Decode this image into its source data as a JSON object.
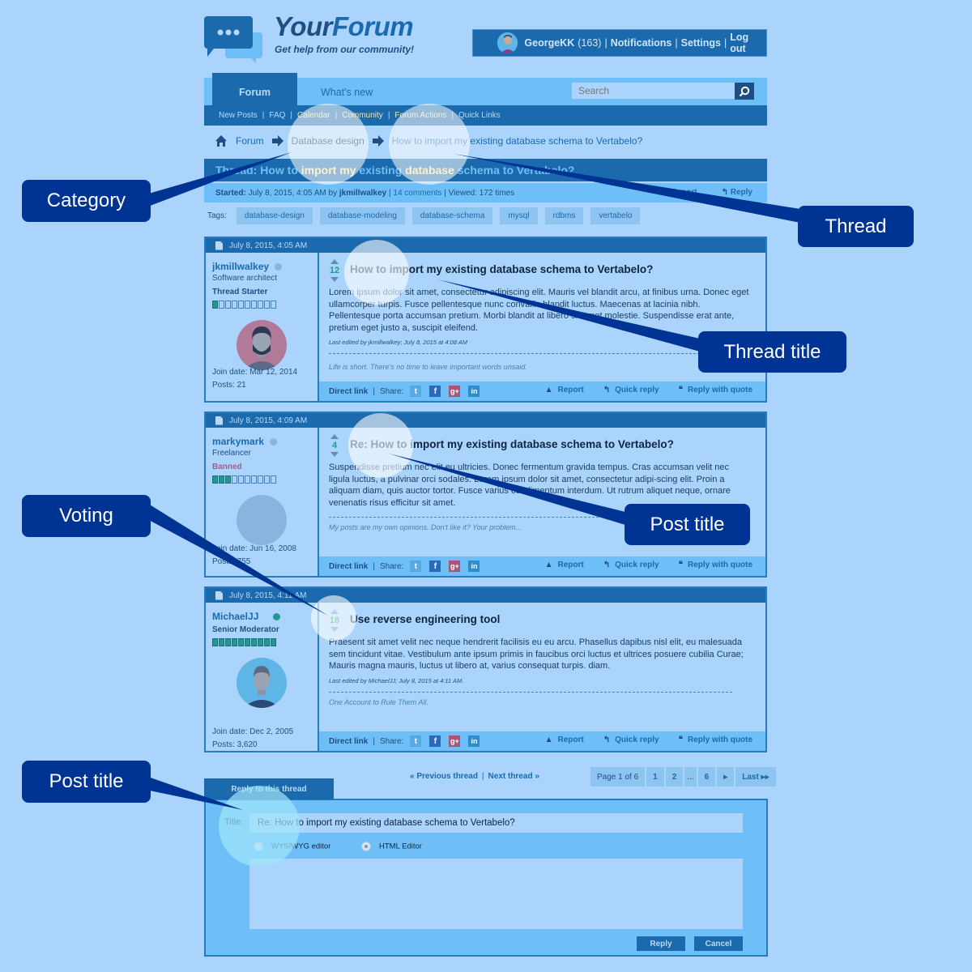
{
  "brand": {
    "name_part1": "Your",
    "name_part2": "Forum",
    "tagline": "Get help from our community!",
    "logo_icon": "chat-bubbles-icon"
  },
  "userbar": {
    "username": "GeorgeKK",
    "reputation": "(163)",
    "links": [
      "Notifications",
      "Settings",
      "Log out"
    ]
  },
  "nav": {
    "tabs": [
      "Forum",
      "What's new"
    ],
    "active_tab": "Forum",
    "search_placeholder": "Search",
    "subnav": [
      {
        "label": "New Posts",
        "highlight": false
      },
      {
        "label": "FAQ",
        "highlight": false
      },
      {
        "label": "Calendar",
        "highlight": true
      },
      {
        "label": "Community",
        "highlight": true
      },
      {
        "label": "Forum Actions",
        "highlight": true
      },
      {
        "label": "Quick Links",
        "highlight": false
      }
    ]
  },
  "breadcrumb": [
    "Forum",
    "Database design",
    "How to import my existing database schema to Vertabelo?"
  ],
  "thread": {
    "title_prefix": "Thread: ",
    "title_parts": [
      {
        "text": "How to ",
        "hl": false
      },
      {
        "text": "import my",
        "hl": true
      },
      {
        "text": " existing ",
        "hl": false
      },
      {
        "text": "database",
        "hl": true
      },
      {
        "text": " schema to Vertabelo?",
        "hl": false
      }
    ],
    "started_label": "Started:",
    "started_date": "July 8, 2015, 4:05 AM by",
    "started_by": "jkmillwalkey",
    "comments": "14 comments",
    "viewed": "Viewed: 172 times",
    "report": "Report",
    "reply": "Reply",
    "tags_label": "Tags:",
    "tags": [
      "database-design",
      "database-modeling",
      "database-schema",
      "mysql",
      "rdbms",
      "vertabelo"
    ]
  },
  "posts": [
    {
      "date": "July 8, 2015, 4:05 AM",
      "author": "jkmillwalkey",
      "online": false,
      "user_title": "Software architect",
      "rank": "Thread Starter",
      "rank_banned": false,
      "reputation_level": 1,
      "reputation_max": 10,
      "join": "Join date: Mar 12, 2014",
      "posts": "Posts: 21",
      "votes": "12",
      "title": "How to import my existing database schema to Vertabelo?",
      "body": "Lorem ipsum dolor sit amet, consectetur adipiscing elit. Mauris vel blandit arcu, at finibus urna. Donec eget ullamcorper turpis. Fusce pellentesque nunc convallis blandit luctus. Maecenas at lacinia nibh. Pellentesque porta accumsan pretium. Morbi blandit at libero sit amet molestie. Suspendisse erat ante, pretium eget justo a, suscipit eleifend.",
      "edited": "Last edited by jkmillwalkey; July 8, 2015 at 4:08 AM",
      "signature": "Life is short. There's no time to leave important words unsaid."
    },
    {
      "date": "July 8, 2015, 4:09 AM",
      "author": "markymark",
      "online": false,
      "user_title": "Freelancer",
      "rank": "Banned",
      "rank_banned": true,
      "reputation_level": 3,
      "reputation_max": 10,
      "join": "Join date: Jun 16, 2008",
      "posts": "Posts: 755",
      "votes": "4",
      "title": "Re: How to import my existing database schema to Vertabelo?",
      "body": "Suspendisse pretium nec elit eu ultricies. Donec fermentum gravida tempus. Cras accumsan velit nec ligula luctus, a pulvinar orci sodales. Lorem ipsum dolor sit amet, consectetur adipi-scing elit. Proin a aliquam diam, quis auctor tortor. Fusce varius condimentum interdum. Ut rutrum aliquet neque, ornare venenatis risus efficitur sit amet.",
      "edited": "",
      "signature": "My posts are my own opinions. Don't like it? Your problem..."
    },
    {
      "date": "July 8, 2015, 4:11 AM",
      "author": "MichaelJJ",
      "online": true,
      "user_title": "",
      "rank": "Senior Moderator",
      "rank_banned": false,
      "reputation_level": 10,
      "reputation_max": 10,
      "join": "Join date: Dec 2, 2005",
      "posts": "Posts: 3,620",
      "votes": "18",
      "title": "Use reverse engineering tool",
      "body": "Praesent sit amet velit nec neque hendrerit facilisis eu eu arcu. Phasellus dapibus nisl elit, eu malesuada sem tincidunt vitae. Vestibulum ante ipsum primis in faucibus orci luctus et ultrices posuere cubilia Curae; Mauris magna mauris, luctus ut libero at, varius consequat turpis. diam.",
      "edited": "Last edited by MichaelJJ; July 8, 2015 at 4:11 AM.",
      "signature": "One Account to Rule Them All."
    }
  ],
  "post_actions": {
    "direct_link": "Direct link",
    "share": "Share:",
    "social": [
      "twitter-icon",
      "facebook-icon",
      "google-plus-icon",
      "linkedin-icon"
    ],
    "report": "Report",
    "quick_reply": "Quick reply",
    "reply_with_quote": "Reply with quote"
  },
  "pagination": {
    "prev_thread": "« Previous thread",
    "next_thread": "Next thread »",
    "page_info": "Page 1 of 6",
    "pages": [
      "1",
      "2",
      "...",
      "6"
    ],
    "next_icon": "▸",
    "last": "Last ▸▸"
  },
  "reply_form": {
    "tab": "Reply to this thread",
    "title_label": "Title:",
    "title_value": "Re: How to import my existing database schema to Vertabelo?",
    "editor_options": [
      "WYSIWYG editor",
      "HTML Editor"
    ],
    "selected_editor": "HTML Editor",
    "reply_button": "Reply",
    "cancel_button": "Cancel"
  },
  "annotations": [
    "Category",
    "Thread",
    "Thread title",
    "Post title",
    "Voting",
    "Post title"
  ],
  "colors": {
    "background": "#aad4fc",
    "primary": "#1a6aad",
    "light": "#6ebff8",
    "highlight_text": "#f2e7a5",
    "callout": "#003494",
    "vote": "#1e9a8e",
    "banned": "#a85a86"
  }
}
